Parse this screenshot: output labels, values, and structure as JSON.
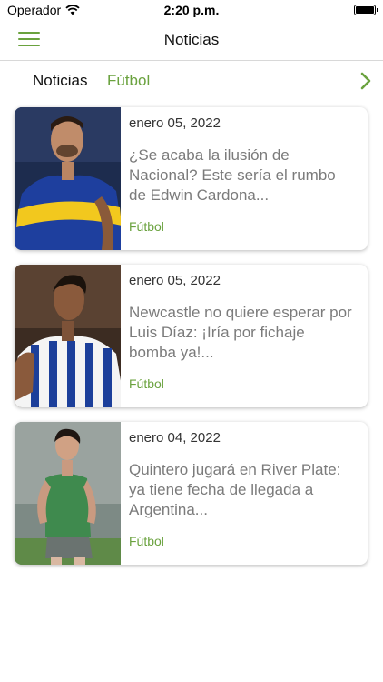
{
  "status_bar": {
    "carrier": "Operador",
    "time": "2:20 p.m."
  },
  "nav": {
    "title": "Noticias",
    "menu_icon": "hamburger-menu-icon"
  },
  "tabs": [
    {
      "label": "Noticias",
      "active": false
    },
    {
      "label": "Fútbol",
      "active": true
    }
  ],
  "colors": {
    "accent": "#6aa23e",
    "title_text": "#7b7b7b"
  },
  "articles": [
    {
      "date": "enero 05, 2022",
      "title": "¿Se acaba la ilusión de Nacional? Este sería el rumbo de Edwin Cardona...",
      "category": "Fútbol",
      "thumbnail": "player-boca-juniors-kit"
    },
    {
      "date": "enero 05, 2022",
      "title": "Newcastle no quiere esperar por Luis Díaz: ¡Iría por fichaje bomba ya!...",
      "category": "Fútbol",
      "thumbnail": "player-porto-kit"
    },
    {
      "date": "enero 04, 2022",
      "title": "Quintero jugará en River Plate: ya tiene fecha de llegada a Argentina...",
      "category": "Fútbol",
      "thumbnail": "player-green-kit"
    }
  ]
}
